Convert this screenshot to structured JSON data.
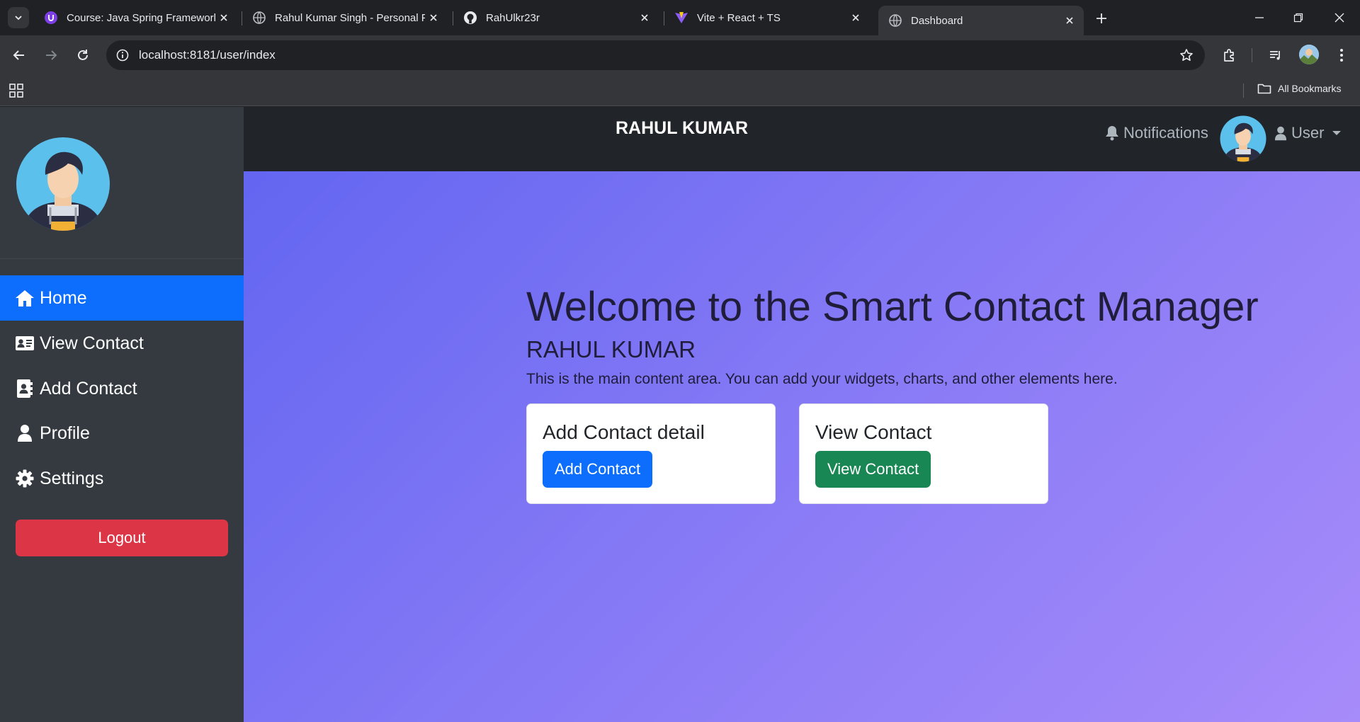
{
  "browser": {
    "tabs": [
      {
        "title": "Course: Java Spring Framework",
        "favicon": "course-icon"
      },
      {
        "title": "Rahul Kumar Singh - Personal P",
        "favicon": "globe-icon"
      },
      {
        "title": "RahUlkr23r",
        "favicon": "github-icon"
      },
      {
        "title": "Vite + React + TS",
        "favicon": "vite-icon"
      },
      {
        "title": "Dashboard",
        "favicon": "globe-icon",
        "active": true
      }
    ],
    "url": "localhost:8181/user/index",
    "bookmarks_label": "All Bookmarks"
  },
  "sidebar": {
    "items": [
      {
        "label": "Home",
        "icon": "home-icon",
        "active": true
      },
      {
        "label": "View Contact",
        "icon": "contact-card-icon"
      },
      {
        "label": "Add Contact",
        "icon": "address-book-icon"
      },
      {
        "label": "Profile",
        "icon": "user-icon"
      },
      {
        "label": "Settings",
        "icon": "gear-icon"
      }
    ],
    "logout_label": "Logout"
  },
  "topbar": {
    "brand": "RAHUL KUMAR",
    "notifications_label": "Notifications",
    "user_label": "User"
  },
  "main": {
    "welcome": "Welcome to the Smart Contact Manager",
    "name": "RAHUL KUMAR",
    "description": "This is the main content area. You can add your widgets, charts, and other elements here.",
    "cards": [
      {
        "title": "Add Contact detail",
        "button": "Add Contact",
        "button_color": "#0d6efd"
      },
      {
        "title": "View Contact",
        "button": "View Contact",
        "button_color": "#198754"
      }
    ]
  },
  "colors": {
    "sidebar_bg": "#343a40",
    "topbar_bg": "#212529",
    "active_nav": "#0d6efd",
    "logout": "#dc3545",
    "gradient_start": "#6366f1",
    "gradient_end": "#a78bfa"
  }
}
